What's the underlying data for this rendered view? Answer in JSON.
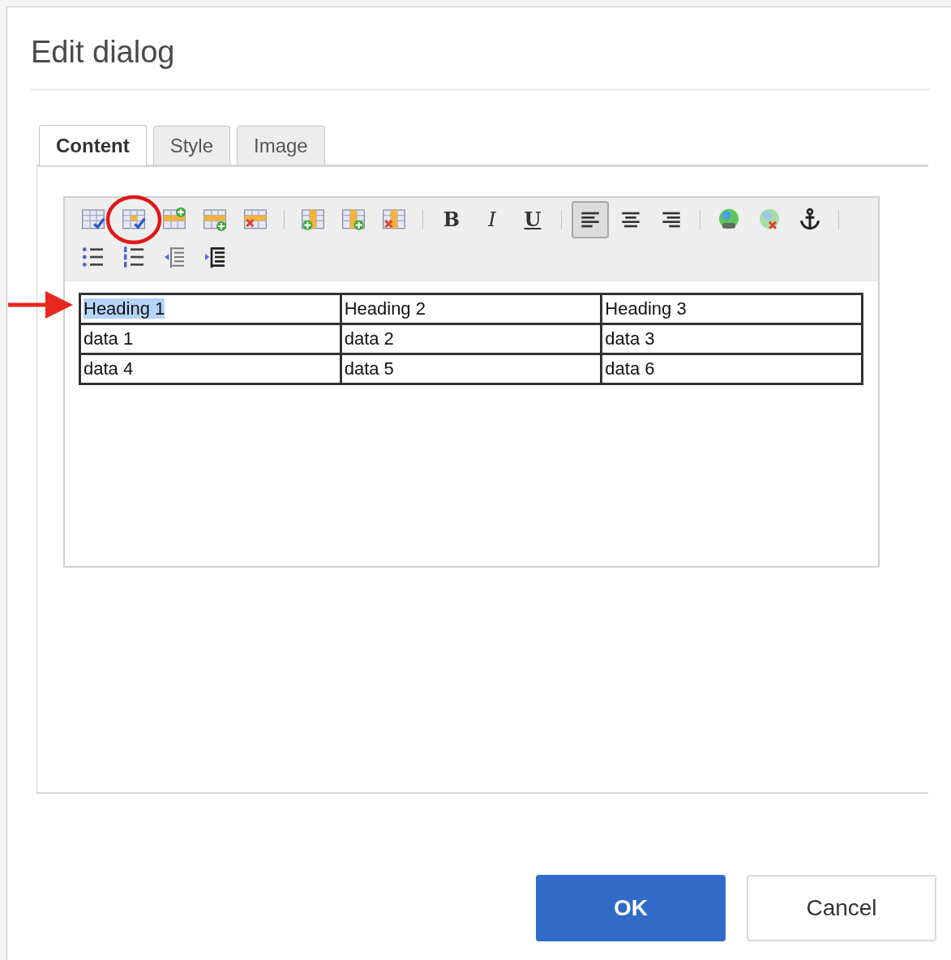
{
  "dialog": {
    "title": "Edit dialog"
  },
  "tabs": [
    {
      "label": "Content",
      "selected": true
    },
    {
      "label": "Style",
      "selected": false
    },
    {
      "label": "Image",
      "selected": false
    }
  ],
  "toolbar": {
    "rows": [
      [
        {
          "kind": "table-check",
          "selected": false,
          "circled": false
        },
        {
          "kind": "cell-check",
          "selected": false,
          "circled": true
        },
        {
          "kind": "row-add-above",
          "selected": false,
          "circled": false
        },
        {
          "kind": "row-add-below",
          "selected": false,
          "circled": false
        },
        {
          "kind": "row-delete",
          "selected": false,
          "circled": false
        },
        {
          "kind": "separator"
        },
        {
          "kind": "col-add-left",
          "selected": false,
          "circled": false
        },
        {
          "kind": "col-add-right",
          "selected": false,
          "circled": false
        },
        {
          "kind": "col-delete",
          "selected": false,
          "circled": false
        },
        {
          "kind": "separator"
        },
        {
          "kind": "bold",
          "text": "B",
          "selected": false,
          "circled": false
        },
        {
          "kind": "italic",
          "text": "I",
          "selected": false,
          "circled": false
        },
        {
          "kind": "underline",
          "text": "U",
          "selected": false,
          "circled": false
        },
        {
          "kind": "separator"
        },
        {
          "kind": "align-left",
          "selected": true,
          "circled": false
        },
        {
          "kind": "align-center",
          "selected": false,
          "circled": false
        },
        {
          "kind": "align-right",
          "selected": false,
          "circled": false
        },
        {
          "kind": "separator"
        },
        {
          "kind": "link",
          "selected": false,
          "circled": false
        },
        {
          "kind": "unlink",
          "selected": false,
          "circled": false
        },
        {
          "kind": "anchor",
          "selected": false,
          "circled": false
        },
        {
          "kind": "separator"
        }
      ],
      [
        {
          "kind": "bullet-list",
          "selected": false,
          "circled": false
        },
        {
          "kind": "number-list",
          "selected": false,
          "circled": false
        },
        {
          "kind": "outdent",
          "selected": false,
          "circled": false
        },
        {
          "kind": "indent",
          "selected": false,
          "circled": false
        }
      ]
    ]
  },
  "table": {
    "rows": [
      [
        {
          "text": "Heading 1",
          "highlighted": true
        },
        {
          "text": "Heading 2",
          "highlighted": false
        },
        {
          "text": "Heading 3",
          "highlighted": false
        }
      ],
      [
        {
          "text": "data 1",
          "highlighted": false
        },
        {
          "text": "data 2",
          "highlighted": false
        },
        {
          "text": "data 3",
          "highlighted": false
        }
      ],
      [
        {
          "text": "data 4",
          "highlighted": false
        },
        {
          "text": "data 5",
          "highlighted": false
        },
        {
          "text": "data 6",
          "highlighted": false
        }
      ]
    ]
  },
  "buttons": [
    {
      "label": "OK",
      "kind": "primary"
    },
    {
      "label": "Cancel",
      "kind": "secondary"
    }
  ]
}
